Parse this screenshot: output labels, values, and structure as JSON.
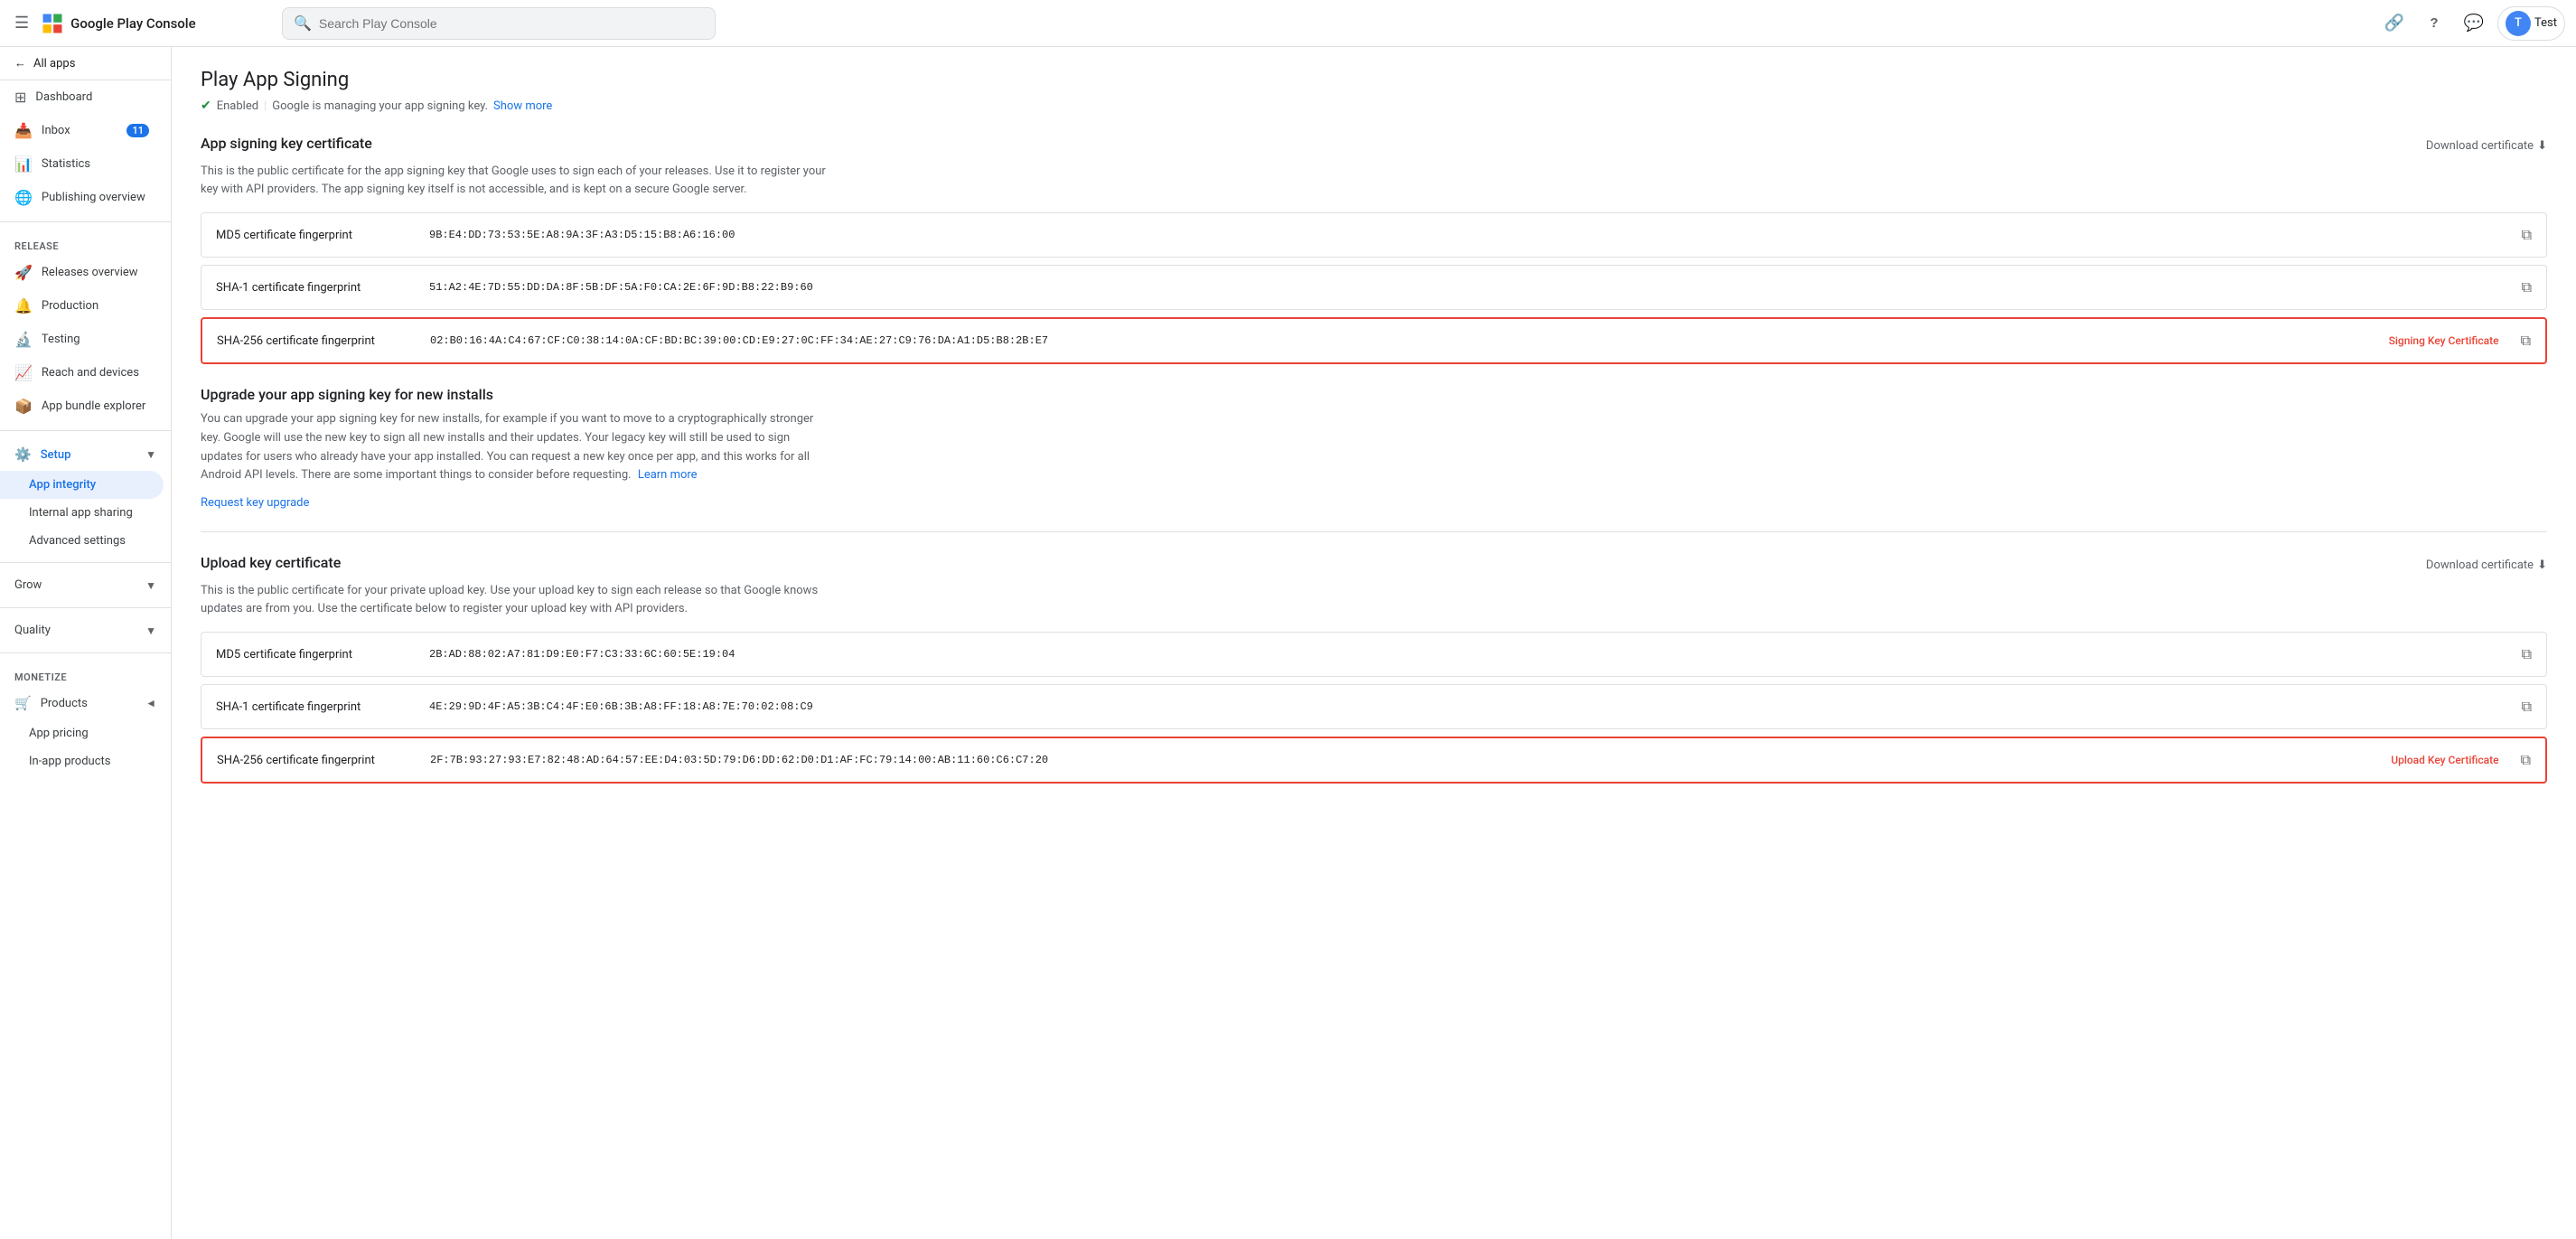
{
  "topbar": {
    "brand_name": "Google Play Console",
    "search_placeholder": "Search Play Console",
    "link_icon": "🔗",
    "help_icon": "?",
    "feedback_icon": "💬",
    "user_label": "Test"
  },
  "sidebar": {
    "all_apps_label": "All apps",
    "nav_items": [
      {
        "id": "dashboard",
        "label": "Dashboard",
        "icon": "grid_view",
        "badge": null
      },
      {
        "id": "inbox",
        "label": "Inbox",
        "icon": "inbox",
        "badge": "11"
      },
      {
        "id": "statistics",
        "label": "Statistics",
        "icon": "bar_chart",
        "badge": null
      },
      {
        "id": "publishing_overview",
        "label": "Publishing overview",
        "icon": "language",
        "badge": null
      }
    ],
    "release_section": "Release",
    "release_items": [
      {
        "id": "releases_overview",
        "label": "Releases overview",
        "icon": "rocket_launch"
      },
      {
        "id": "production",
        "label": "Production",
        "icon": "notifications"
      },
      {
        "id": "testing",
        "label": "Testing",
        "icon": "science"
      },
      {
        "id": "reach_and_devices",
        "label": "Reach and devices",
        "icon": "bar_chart"
      },
      {
        "id": "app_bundle_explorer",
        "label": "App bundle explorer",
        "icon": "folder_zip"
      }
    ],
    "setup_label": "Setup",
    "setup_sub_items": [
      {
        "id": "app_integrity",
        "label": "App integrity",
        "active": true
      },
      {
        "id": "internal_app_sharing",
        "label": "Internal app sharing"
      },
      {
        "id": "advanced_settings",
        "label": "Advanced settings"
      }
    ],
    "grow_label": "Grow",
    "quality_label": "Quality",
    "monetize_label": "Monetize",
    "products_label": "Products",
    "app_pricing_label": "App pricing",
    "in_app_products_label": "In-app products"
  },
  "content": {
    "page_title": "Play App Signing",
    "status_text": "Enabled",
    "status_desc": "Google is managing your app signing key.",
    "show_more": "Show more",
    "app_signing_section": {
      "title": "App signing key certificate",
      "download_label": "Download certificate",
      "desc": "This is the public certificate for the app signing key that Google uses to sign each of your releases. Use it to register your key with API providers. The app signing key itself is not accessible, and is kept on a secure Google server.",
      "rows": [
        {
          "label": "MD5 certificate fingerprint",
          "value": "9B:E4:DD:73:53:5E:A8:9A:3F:A3:D5:15:B8:A6:16:00",
          "highlighted": false,
          "badge": ""
        },
        {
          "label": "SHA-1 certificate fingerprint",
          "value": "51:A2:4E:7D:55:DD:DA:8F:5B:DF:5A:F0:CA:2E:6F:9D:B8:22:B9:60",
          "highlighted": false,
          "badge": ""
        },
        {
          "label": "SHA-256 certificate fingerprint",
          "value": "02:B0:16:4A:C4:67:CF:C0:38:14:0A:CF:BD:BC:39:00:CD:E9:27:0C:FF:34:AE:27:C9:76:DA:A1:D5:B8:2B:E7",
          "highlighted": true,
          "badge": "Signing Key Certificate"
        }
      ]
    },
    "upgrade_section": {
      "title": "Upgrade your app signing key for new installs",
      "desc": "You can upgrade your app signing key for new installs, for example if you want to move to a cryptographically stronger key. Google will use the new key to sign all new installs and their updates. Your legacy key will still be used to sign updates for users who already have your app installed. You can request a new key once per app, and this works for all Android API levels. There are some important things to consider before requesting.",
      "learn_more": "Learn more",
      "request_link": "Request key upgrade"
    },
    "upload_section": {
      "title": "Upload key certificate",
      "download_label": "Download certificate",
      "desc": "This is the public certificate for your private upload key. Use your upload key to sign each release so that Google knows updates are from you. Use the certificate below to register your upload key with API providers.",
      "rows": [
        {
          "label": "MD5 certificate fingerprint",
          "value": "2B:AD:88:02:A7:81:D9:E0:F7:C3:33:6C:60:5E:19:04",
          "highlighted": false,
          "badge": ""
        },
        {
          "label": "SHA-1 certificate fingerprint",
          "value": "4E:29:9D:4F:A5:3B:C4:4F:E0:6B:3B:A8:FF:18:A8:7E:70:02:08:C9",
          "highlighted": false,
          "badge": ""
        },
        {
          "label": "SHA-256 certificate fingerprint",
          "value": "2F:7B:93:27:93:E7:82:48:AD:64:57:EE:D4:03:5D:79:D6:DD:62:D0:D1:AF:FC:79:14:00:AB:11:60:C6:C7:20",
          "highlighted": true,
          "badge": "Upload Key Certificate"
        }
      ]
    }
  }
}
